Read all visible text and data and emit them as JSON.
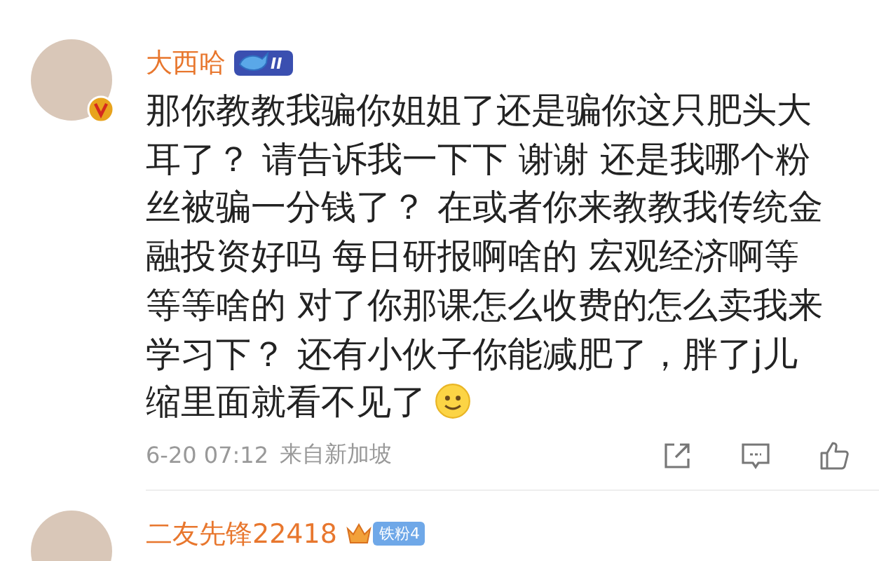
{
  "comments": [
    {
      "author": "大西哈",
      "verified": true,
      "badge": {
        "kind": "level",
        "label": "II"
      },
      "text": "那你教教我骗你姐姐了还是骗你这只肥头大耳了？ 请告诉我一下下 谢谢 还是我哪个粉丝被骗一分钱了？ 在或者你来教教我传统金融投资好吗 每日研报啊啥的 宏观经济啊等等等啥的 对了你那课怎么收费的怎么卖我来学习下？ 还有小伙子你能减肥了，胖了j儿缩里面就看不见了",
      "emoji": true,
      "time": "6-20 07:12",
      "location": "来自新加坡"
    },
    {
      "author": "二友先锋22418",
      "verified": false,
      "badge": {
        "kind": "fan",
        "label": "铁粉4"
      }
    }
  ]
}
